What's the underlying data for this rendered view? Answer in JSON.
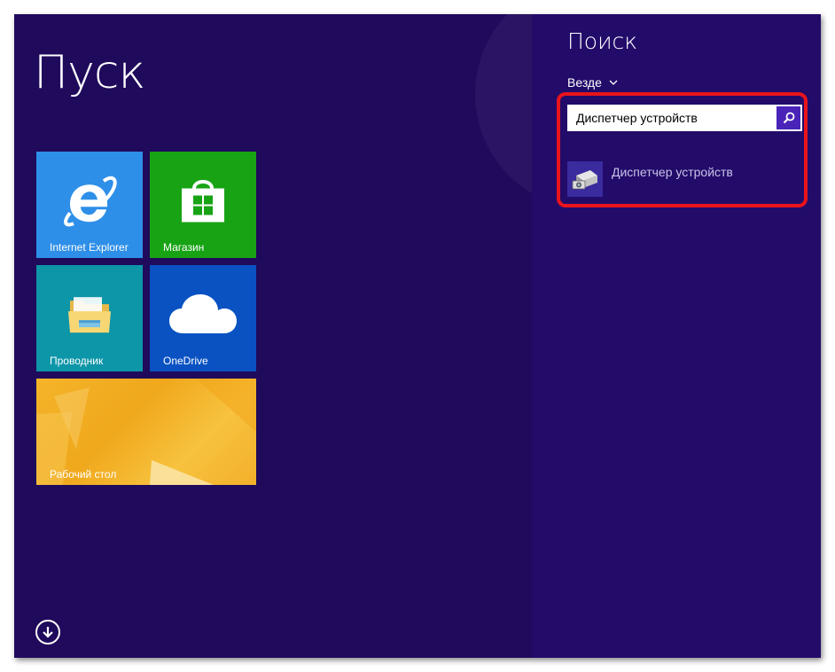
{
  "start": {
    "title": "Пуск",
    "tiles": {
      "ie": {
        "label": "Internet Explorer",
        "color": "#2e8fe8",
        "icon": "internet-explorer-icon"
      },
      "store": {
        "label": "Магазин",
        "color": "#18a315",
        "icon": "store-icon"
      },
      "explorer": {
        "label": "Проводник",
        "color": "#0d95a8",
        "icon": "folder-icon"
      },
      "onedrive": {
        "label": "OneDrive",
        "color": "#0a52c2",
        "icon": "cloud-icon"
      },
      "desktop": {
        "label": "Рабочий стол",
        "color": "#f4b42a",
        "icon": "desktop-wallpaper"
      }
    },
    "apps_button_icon": "arrow-down-circle-icon",
    "background": "#1f0a5c"
  },
  "search": {
    "title": "Поиск",
    "scope": "Везде",
    "query": "Диспетчер устройств",
    "button_icon": "search-icon",
    "results": [
      {
        "label": "Диспетчер устройств",
        "icon": "device-manager-icon"
      }
    ],
    "highlight_color": "#e8141b",
    "background": "#230b6a"
  }
}
